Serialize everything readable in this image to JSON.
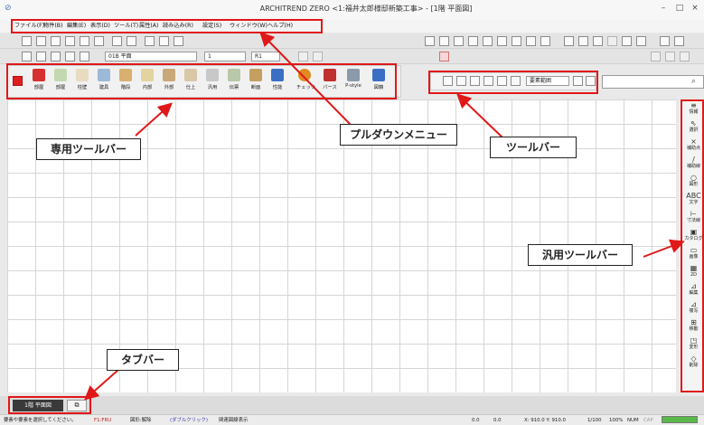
{
  "window": {
    "title": "ARCHITREND ZERO <1:福井太郎様邸新築工事> - [1階 平面図]",
    "minimize": "–",
    "maximize": "□",
    "close": "×"
  },
  "menu": [
    "ファイル(F)",
    "物件(B)",
    "編集(E)",
    "表示(D)",
    "ツール(T)",
    "属性(A)",
    "読み込み(R)",
    "設定(S)",
    "ウィンドウ(W)",
    "ヘルプ(H)"
  ],
  "toolbar_row2": {
    "floor_select": "01B 平面",
    "line_select": "1",
    "layer_select": "R1"
  },
  "special_tools": [
    "部屋",
    "部屋",
    "柱壁",
    "建具",
    "階段",
    "内部",
    "外部",
    "仕上",
    "汎用",
    "伝票",
    "断面",
    "性能",
    "チェック",
    "パース",
    "P-style",
    "図籍"
  ],
  "general_toolbar": {
    "range_label": "要素範囲"
  },
  "side_tools": [
    {
      "icon": "≡",
      "label": "情報"
    },
    {
      "icon": "⇖",
      "label": "選択"
    },
    {
      "icon": "×",
      "label": "補助点"
    },
    {
      "icon": "/",
      "label": "補助線"
    },
    {
      "icon": "○",
      "label": "図形"
    },
    {
      "icon": "ABC",
      "label": "文字"
    },
    {
      "icon": "⊢",
      "label": "寸法線"
    },
    {
      "icon": "▣",
      "label": "カタログ"
    },
    {
      "icon": "▭",
      "label": "画像"
    },
    {
      "icon": "▦",
      "label": "2D"
    },
    {
      "icon": "⊿",
      "label": "編集"
    },
    {
      "icon": "⊿",
      "label": "複写"
    },
    {
      "icon": "⊞",
      "label": "移動"
    },
    {
      "icon": "◳",
      "label": "変形"
    },
    {
      "icon": "◇",
      "label": "削除"
    }
  ],
  "callouts": {
    "special_toolbar": "専用ツールバー",
    "pulldown_menu": "プルダウンメニュー",
    "toolbar": "ツールバー",
    "general_toolbar": "汎用ツールバー",
    "tab_bar": "タブバー"
  },
  "tab_bar": {
    "active_tab": "1階 平面図"
  },
  "status": {
    "hint": "要素や要素を選択してください。",
    "f1": "F1:FRU",
    "f2": "図形:解除",
    "f3": "(ダブルクリック)",
    "f4": "関連図線表示",
    "coord_a": "0.0",
    "coord_b": "0.0",
    "coord_xy": "X: 910.0 Y: 910.0",
    "scale": "1/100",
    "pct": "100%",
    "num": "NUM",
    "caps": "CAP"
  },
  "colors": {
    "callout_border": "#e01818",
    "grid": "#d6d6d6",
    "accent_blue": "#3a6fc4"
  }
}
